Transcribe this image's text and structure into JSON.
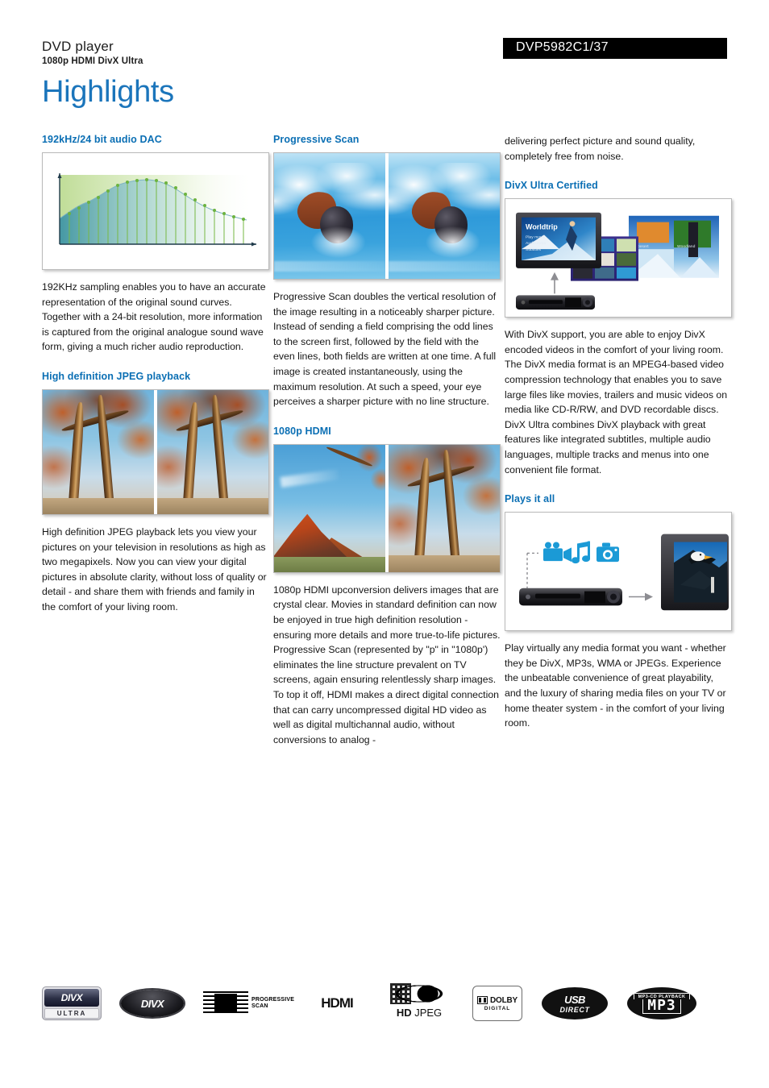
{
  "header": {
    "product_kind": "DVD player",
    "product_subtitle": "1080p HDMI DivX Ultra",
    "model_number": "DVP5982C1/37",
    "page_title": "Highlights",
    "accent_color": "#0b6fb4",
    "title_color": "#1b75BB",
    "model_bar_bg": "#000000"
  },
  "columns": {
    "left": {
      "sections": [
        {
          "heading": "192kHz/24 bit audio DAC",
          "image_name": "audio-dac-sampling-chart",
          "body": "192KHz sampling enables you to have an accurate representation of the original sound curves. Together with a 24-bit resolution, more information is captured from the original analogue sound wave form, giving a much richer audio reproduction."
        },
        {
          "heading": "High definition JPEG playback",
          "image_name": "autumn-trees-comparison-photo",
          "body": "High definition JPEG playback lets you view your pictures on your television in resolutions as high as two megapixels. Now you can view your digital pictures in absolute clarity, without loss of quality or detail - and share them with friends and family in the comfort of your living room."
        }
      ]
    },
    "middle": {
      "sections": [
        {
          "heading": "Progressive Scan",
          "image_name": "swimmer-comparison-photo",
          "body": "Progressive Scan doubles the vertical resolution of the image resulting in a noticeably sharper picture. Instead of sending a field comprising the odd lines to the screen first, followed by the field with the even lines, both fields are written at one time. A full image is created instantaneously, using the maximum resolution. At such a speed, your eye perceives a sharper picture with no line structure."
        },
        {
          "heading": "1080p HDMI",
          "image_name": "mountain-tree-comparison-photo",
          "body": "1080p HDMI upconversion delivers images that are crystal clear. Movies in standard definition can now be enjoyed in true high definition resolution - ensuring more details and more true-to-life pictures. Progressive Scan (represented by \"p\" in \"1080p') eliminates the line structure prevalent on TV screens, again ensuring relentlessly sharp images. To top it off, HDMI makes a direct digital connection that can carry uncompressed digital HD video as well as digital multichannal audio, without conversions to analog -"
        }
      ]
    },
    "right": {
      "continued_text": "delivering perfect picture and sound quality, completely free from noise.",
      "sections": [
        {
          "heading": "DivX Ultra Certified",
          "image_name": "divx-ultra-menu-illustration",
          "body": "With DivX support, you are able to enjoy DivX encoded videos in the comfort of your living room. The DivX media format is an MPEG4-based video compression technology that enables you to save large files like movies, trailers and music videos on media like CD-R/RW, and DVD recordable discs. DivX Ultra combines DivX playback with great features like integrated subtitles, multiple audio languages, multiple tracks and menus into one convenient file format."
        },
        {
          "heading": "Plays it all",
          "image_name": "plays-it-all-illustration",
          "body": "Play virtually any media format you want - whether they be DivX, MP3s, WMA or JPEGs. Experience the unbeatable convenience of great playability, and the luxury of sharing media files on your TV or home theater system - in the comfort of your living room."
        }
      ]
    }
  },
  "divx_illustration": {
    "tv_menu_title": "Worldtrip",
    "tv_menu_items": [
      "Play movie",
      "Audio extra",
      "Subtitles"
    ],
    "thumbnail_labels": [
      "Desert",
      "Woodland"
    ]
  },
  "footer_logos": [
    {
      "name": "divx-ultra-logo",
      "primary": "DIVX",
      "secondary": "ULTRA"
    },
    {
      "name": "divx-logo",
      "primary": "DIVX",
      "secondary": ""
    },
    {
      "name": "progressive-scan-logo",
      "primary": "PROGRESSIVE",
      "secondary": "SCAN"
    },
    {
      "name": "hdmi-logo",
      "primary": "HDMI",
      "secondary": ""
    },
    {
      "name": "hd-jpeg-logo",
      "primary": "HD",
      "secondary": "JPEG"
    },
    {
      "name": "dolby-digital-logo",
      "primary": "DOLBY",
      "secondary": "DIGITAL"
    },
    {
      "name": "usb-direct-logo",
      "primary": "USB",
      "secondary": "DIRECT"
    },
    {
      "name": "mp3-cd-playback-logo",
      "primary": "MP3-CD PLAYBACK",
      "secondary": "MP3"
    }
  ]
}
